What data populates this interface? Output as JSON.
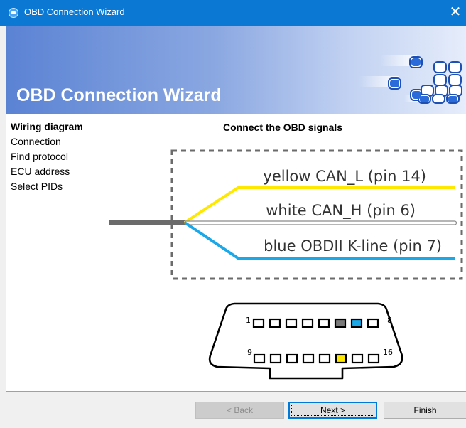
{
  "window": {
    "title": "OBD Connection Wizard",
    "close_glyph": "✕",
    "app_icon": "obd-app-icon"
  },
  "banner": {
    "heading": "OBD Connection Wizard",
    "logo_icon": "connector-dots-logo"
  },
  "sidebar": {
    "items": [
      {
        "label": "Wiring diagram",
        "active": true
      },
      {
        "label": "Connection",
        "active": false
      },
      {
        "label": "Find protocol",
        "active": false
      },
      {
        "label": "ECU address",
        "active": false
      },
      {
        "label": "Select PIDs",
        "active": false
      }
    ]
  },
  "content": {
    "header": "Connect the OBD signals",
    "wires": [
      {
        "label": "yellow CAN_L (pin 14)",
        "color": "#ffe800"
      },
      {
        "label": "white CAN_H (pin 6)",
        "color": "#ffffff"
      },
      {
        "label": "blue OBDII K-line (pin 7)",
        "color": "#1aa8e8"
      }
    ],
    "connector": {
      "top_start": "1",
      "top_end": "8",
      "bottom_start": "9",
      "bottom_end": "16",
      "highlight": {
        "pin6": "#7a7a7a",
        "pin7": "#1aa8e8",
        "pin14": "#ffe800"
      }
    }
  },
  "footer": {
    "back_label": "< Back",
    "next_label": "Next >",
    "finish_label": "Finish"
  }
}
